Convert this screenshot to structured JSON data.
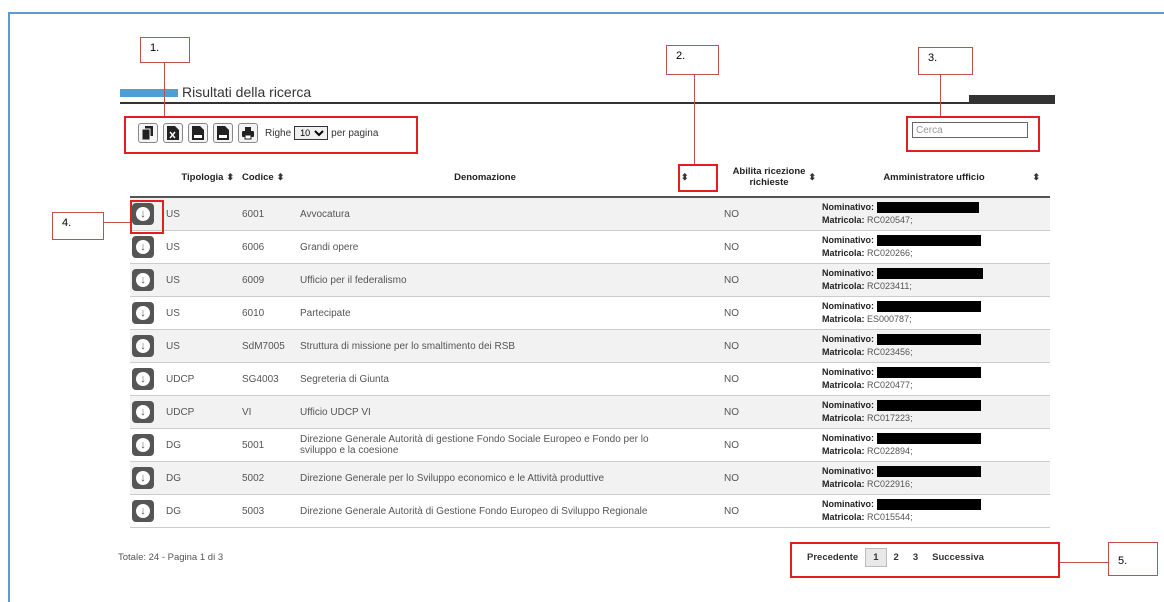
{
  "section_title": "Risultati della ricerca",
  "toolbar": {
    "buttons": [
      {
        "name": "copy",
        "icon": "copy-icon"
      },
      {
        "name": "excel",
        "icon": "excel-icon"
      },
      {
        "name": "csv",
        "icon": "csv-icon"
      },
      {
        "name": "pdf",
        "icon": "pdf-icon"
      },
      {
        "name": "print",
        "icon": "print-icon"
      }
    ],
    "righe_label": "Righe",
    "rows_per_page": "10",
    "per_pagina_label": "per pagina"
  },
  "search": {
    "placeholder": "Cerca"
  },
  "table": {
    "headers": {
      "tipologia": "Tipologia",
      "codice": "Codice",
      "denominazione": "Denomazione",
      "abilita": "Abilita ricezione richieste",
      "amministratore": "Amministratore ufficio"
    },
    "sort_glyph": "⬍",
    "nominativo_label": "Nominativo",
    "matricola_label": "Matricola",
    "rows": [
      {
        "tipologia": "US",
        "codice": "6001",
        "denominazione": "Avvocatura",
        "abilita": "NO",
        "matricola": "RC020547;"
      },
      {
        "tipologia": "US",
        "codice": "6006",
        "denominazione": "Grandi opere",
        "abilita": "NO",
        "matricola": "RC020266;"
      },
      {
        "tipologia": "US",
        "codice": "6009",
        "denominazione": "Ufficio per il federalismo",
        "abilita": "NO",
        "matricola": "RC023411;"
      },
      {
        "tipologia": "US",
        "codice": "6010",
        "denominazione": "Partecipate",
        "abilita": "NO",
        "matricola": "ES000787;"
      },
      {
        "tipologia": "US",
        "codice": "SdM7005",
        "denominazione": "Struttura di missione per lo smaltimento dei RSB",
        "abilita": "NO",
        "matricola": "RC023456;"
      },
      {
        "tipologia": "UDCP",
        "codice": "SG4003",
        "denominazione": "Segreteria di Giunta",
        "abilita": "NO",
        "matricola": "RC020477;"
      },
      {
        "tipologia": "UDCP",
        "codice": "VI",
        "denominazione": "Ufficio UDCP VI",
        "abilita": "NO",
        "matricola": "RC017223;"
      },
      {
        "tipologia": "DG",
        "codice": "5001",
        "denominazione": "Direzione Generale Autorità di gestione Fondo Sociale Europeo e Fondo per lo sviluppo e la coesione",
        "abilita": "NO",
        "matricola": "RC022894;"
      },
      {
        "tipologia": "DG",
        "codice": "5002",
        "denominazione": "Direzione Generale per lo Sviluppo economico e le Attività produttive",
        "abilita": "NO",
        "matricola": "RC022916;"
      },
      {
        "tipologia": "DG",
        "codice": "5003",
        "denominazione": "Direzione Generale Autorità di Gestione Fondo Europeo di Sviluppo Regionale",
        "abilita": "NO",
        "matricola": "RC015544;"
      }
    ]
  },
  "footer": {
    "total": "Totale: 24 - Pagina 1 di 3"
  },
  "pagination": {
    "prev": "Precedente",
    "pages": [
      "1",
      "2",
      "3"
    ],
    "current": "1",
    "next": "Successiva"
  },
  "callouts": [
    "1.",
    "2.",
    "3.",
    "4.",
    "5."
  ],
  "colors": {
    "highlight": "#e02020",
    "frame": "#5b9bd5",
    "title_accent": "#4f9fd0"
  }
}
